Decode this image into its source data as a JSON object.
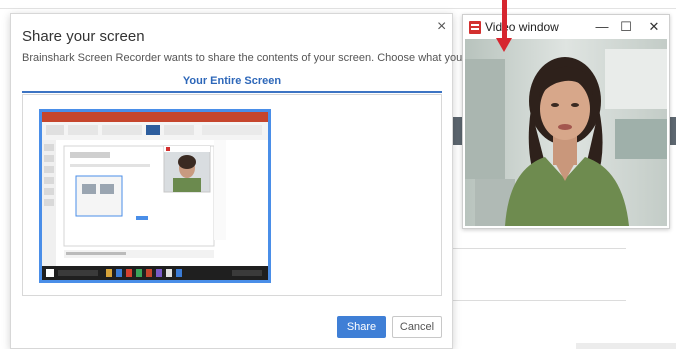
{
  "dialog": {
    "title": "Share your screen",
    "description": "Brainshark Screen Recorder wants to share the contents of your screen. Choose what you'd like to share.",
    "tab_label": "Your Entire Screen",
    "close_glyph": "×",
    "share_label": "Share",
    "cancel_label": "Cancel"
  },
  "video_window": {
    "title": "Video window",
    "minimize_glyph": "—",
    "maximize_glyph": "☐",
    "close_glyph": "✕"
  },
  "colors": {
    "accent_blue": "#3f7fd6",
    "annotation_red": "#d6262f"
  }
}
